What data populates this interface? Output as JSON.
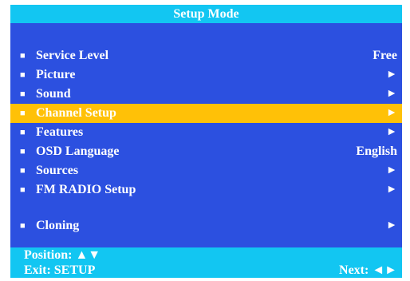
{
  "title": "Setup Mode",
  "bullet_glyph": "■",
  "menu": [
    {
      "label": "Service Level",
      "value": "Free"
    },
    {
      "label": "Picture",
      "value": "►"
    },
    {
      "label": "Sound",
      "value": "►"
    },
    {
      "label": "Channel Setup",
      "value": "►",
      "selected": true
    },
    {
      "label": "Features",
      "value": "►"
    },
    {
      "label": "OSD Language",
      "value": "English"
    },
    {
      "label": "Sources",
      "value": "►"
    },
    {
      "label": "FM RADIO Setup",
      "value": "►"
    },
    {
      "label": "Cloning",
      "value": "►"
    }
  ],
  "footer": {
    "position_text": "Position: ▲▼",
    "exit_text": "Exit: SETUP",
    "next_text": "Next: ◄►"
  },
  "colors": {
    "background": "#2c50e0",
    "header": "#12c6f2",
    "highlight": "#ffc107",
    "text": "#ffffff"
  }
}
